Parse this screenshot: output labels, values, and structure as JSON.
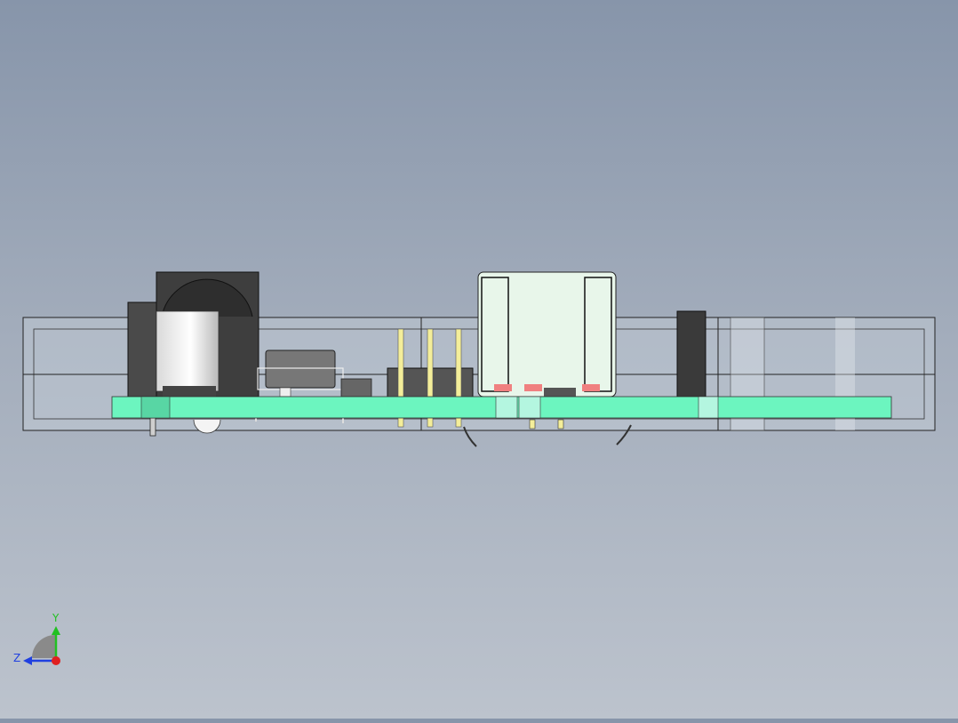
{
  "view": {
    "background_top": "#8795aa",
    "background_bottom": "#bcc3cd"
  },
  "model": {
    "enclosure_color": "#cfd6e0",
    "pcb_color": "#6cf5bf",
    "header_pin_color": "#f4ee9a",
    "component_dark_color": "#3a3a3a",
    "smd_pad_color": "#f08080"
  },
  "triad": {
    "y_label": "Y",
    "z_label": "Z",
    "y_color": "#22c022",
    "z_color": "#2040e0",
    "x_color": "#e02020"
  }
}
